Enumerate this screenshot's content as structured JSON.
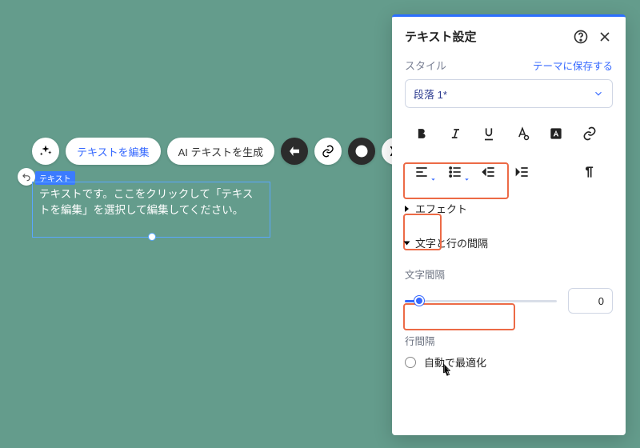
{
  "floatbar": {
    "edit_text": "テキストを編集",
    "ai_generate": "AI テキストを生成"
  },
  "canvas": {
    "element_label": "テキスト",
    "text_content": "テキストです。ここをクリックして「テキストを編集」を選択して編集してください。"
  },
  "panel": {
    "title": "テキスト設定",
    "style_label": "スタイル",
    "save_theme": "テーマに保存する",
    "style_value": "段落 1*",
    "effects": "エフェクト",
    "spacing_section": "文字と行の間隔",
    "char_spacing_label": "文字間隔",
    "char_spacing_value": "0",
    "line_spacing_label": "行間隔",
    "auto_optimize": "自動で最適化"
  },
  "icons": {
    "sparkle": "sparkle-icon",
    "anim": "animation-icon",
    "link": "link-icon",
    "help": "help-icon",
    "stretch": "stretch-icon",
    "undo": "undo-icon"
  }
}
